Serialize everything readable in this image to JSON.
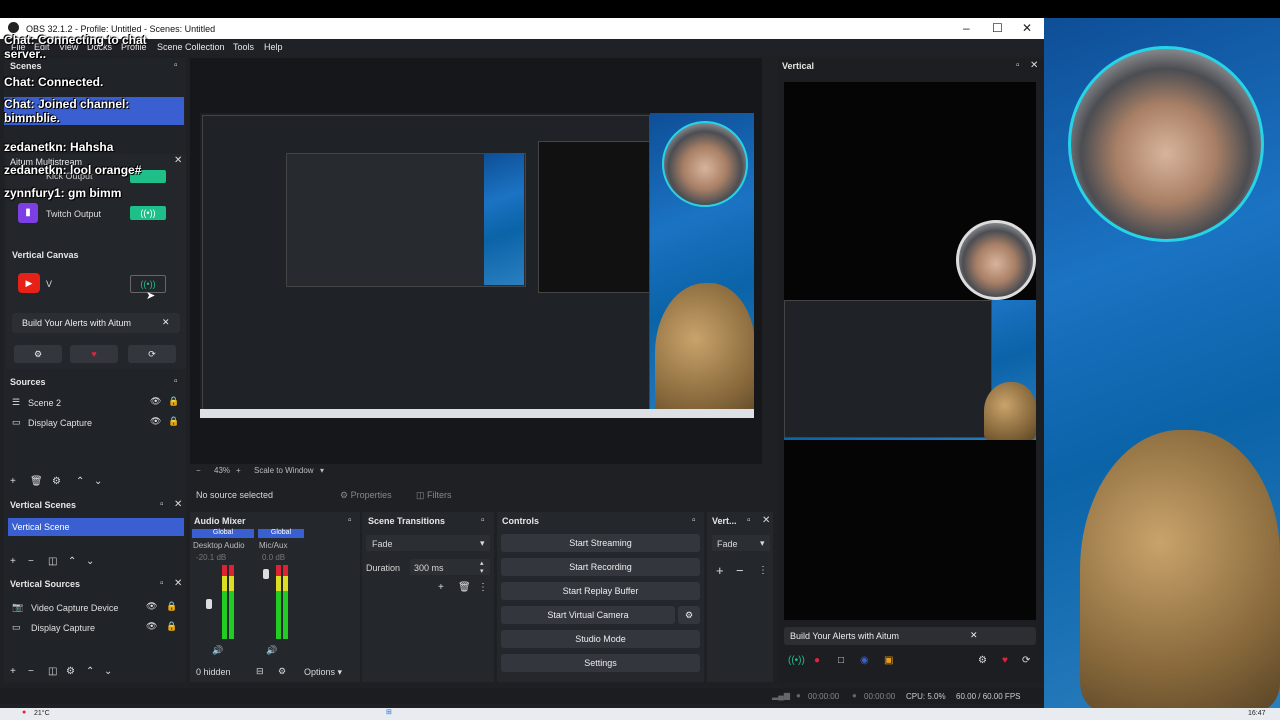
{
  "window": {
    "title": "OBS 32.1.2 - Profile: Untitled - Scenes: Untitled",
    "controls": {
      "minimize": "–",
      "maximize": "☐",
      "close": "✕"
    }
  },
  "menu": [
    "File",
    "Edit",
    "View",
    "Docks",
    "Profile",
    "Scene Collection",
    "Tools",
    "Help"
  ],
  "chat_overlay": [
    {
      "user": "Chat:",
      "text": " Connecting to chat server.."
    },
    {
      "user": "Chat:",
      "text": " Connected."
    },
    {
      "user": "Chat:",
      "text": " Joined channel: bimmblie."
    },
    {
      "user": "zedanetkn:",
      "text": " Hahsha"
    },
    {
      "user": "zedanetkn:",
      "text": " lool orange#"
    },
    {
      "user": "zynnfury1:",
      "text": " gm bimm"
    }
  ],
  "scenes_dock": {
    "title": "Scenes"
  },
  "aitum": {
    "title": "Aitum Multistream",
    "outputs": [
      {
        "label": "Kick Output"
      },
      {
        "label": "Twitch Output"
      }
    ],
    "vertical_canvas_label": "Vertical Canvas",
    "vertical_output": {
      "label": "V"
    },
    "alerts_label": "Build Your Alerts with Aitum"
  },
  "sources": {
    "title": "Sources",
    "items": [
      {
        "label": "Scene 2"
      },
      {
        "label": "Display Capture"
      }
    ]
  },
  "vertical_scenes": {
    "title": "Vertical Scenes",
    "items": [
      {
        "label": "Vertical Scene"
      }
    ]
  },
  "vertical_sources": {
    "title": "Vertical Sources",
    "items": [
      {
        "label": "Video Capture Device"
      },
      {
        "label": "Display Capture"
      }
    ]
  },
  "preview_bar": {
    "zoom": "43%",
    "scale": "Scale to Window"
  },
  "source_toolbar": {
    "status": "No source selected",
    "properties": "Properties",
    "filters": "Filters"
  },
  "audio_mixer": {
    "title": "Audio Mixer",
    "channels": [
      {
        "group": "Global",
        "name": "Desktop Audio",
        "db": "-20.1 dB"
      },
      {
        "group": "Global",
        "name": "Mic/Aux",
        "db": "0.0 dB"
      }
    ],
    "hidden": "0 hidden",
    "options": "Options"
  },
  "scene_transitions": {
    "title": "Scene Transitions",
    "transition": "Fade",
    "duration_label": "Duration",
    "duration_value": "300 ms"
  },
  "controls": {
    "title": "Controls",
    "buttons": [
      "Start Streaming",
      "Start Recording",
      "Start Replay Buffer",
      "Start Virtual Camera",
      "Studio Mode",
      "Settings"
    ]
  },
  "vert_dock": {
    "title": "Vert...",
    "transition": "Fade"
  },
  "vertical_dock": {
    "title": "Vertical",
    "alerts_label": "Build Your Alerts with Aitum"
  },
  "status_bar": {
    "rec_time": "00:00:00",
    "stream_time": "00:00:00",
    "cpu": "CPU: 5.0%",
    "fps": "60.00 / 60.00 FPS"
  },
  "taskbar": {
    "weather": "21°C",
    "clock": "16:47"
  },
  "colors": {
    "accent": "#3a5fd0",
    "live_green": "#1fbf8a",
    "live_red": "#e5223a"
  }
}
